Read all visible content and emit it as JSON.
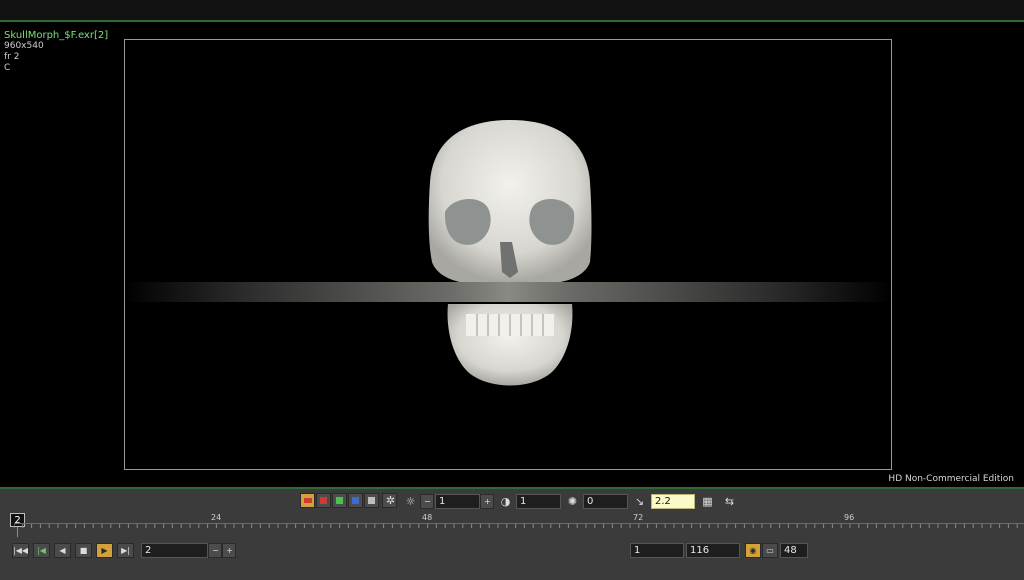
{
  "viewer": {
    "filename": "SkullMorph_$F.exr[2]",
    "resolution": "960x540",
    "frame_label": "fr 2",
    "channel": "C",
    "edition": "HD Non-Commercial Edition"
  },
  "toolbar": {
    "gain_value": "1",
    "gamma_value": "1",
    "offset_value": "0",
    "display_gamma": "2.2",
    "swatch_colors": [
      "#cf3b32",
      "#4bc24b",
      "#3b6bcf"
    ]
  },
  "timeline": {
    "current_frame": "2",
    "tick_labels": [
      "24",
      "48",
      "72",
      "96"
    ]
  },
  "playback": {
    "frame_field": "2",
    "range_start": "1",
    "range_end": "116",
    "fps": "48",
    "buttons": [
      "go-to-start",
      "step-back",
      "play-reverse",
      "stop",
      "play-forward",
      "step-forward"
    ]
  }
}
